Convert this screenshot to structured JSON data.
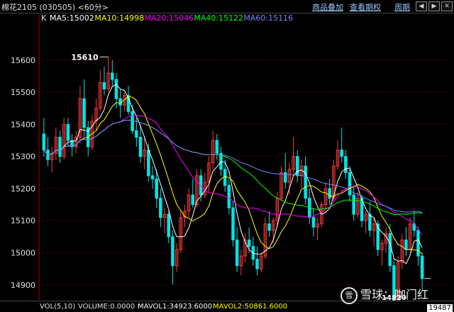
{
  "window": {
    "title": "棉花2105 (030505) <60分>",
    "buttons": [
      "商品叠加",
      "查看期权",
      "周期"
    ],
    "controls": [
      "◀",
      "▶",
      "✕"
    ]
  },
  "chart_data": {
    "type": "candlestick",
    "indicator_prefix": "K",
    "ma_legend": [
      {
        "label": "MA5:15002",
        "color": "#ffffff"
      },
      {
        "label": "MA10:14998",
        "color": "#ffff00"
      },
      {
        "label": "MA20:15046",
        "color": "#ff00ff"
      },
      {
        "label": "MA40:15122",
        "color": "#00ff00"
      },
      {
        "label": "MA60:15116",
        "color": "#8080ff"
      }
    ],
    "y_ticks": [
      15600,
      15500,
      15400,
      15300,
      15200,
      15100,
      15000,
      14900
    ],
    "ylim": [
      14862,
      15710
    ],
    "annotations": [
      {
        "text": "15610",
        "value": 15610
      },
      {
        "text": "14820",
        "value": 14820
      }
    ],
    "colors": {
      "up": "#ff3a3a",
      "down": "#00e5e5",
      "grid": "#8b0000"
    },
    "candles": [
      [
        15370,
        15420,
        15300,
        15320
      ],
      [
        15320,
        15360,
        15270,
        15290
      ],
      [
        15290,
        15330,
        15250,
        15310
      ],
      [
        15310,
        15390,
        15290,
        15360
      ],
      [
        15360,
        15380,
        15280,
        15300
      ],
      [
        15300,
        15420,
        15290,
        15400
      ],
      [
        15400,
        15420,
        15330,
        15350
      ],
      [
        15350,
        15370,
        15300,
        15330
      ],
      [
        15330,
        15380,
        15310,
        15360
      ],
      [
        15360,
        15520,
        15340,
        15480
      ],
      [
        15480,
        15540,
        15360,
        15390
      ],
      [
        15390,
        15410,
        15300,
        15330
      ],
      [
        15330,
        15430,
        15320,
        15410
      ],
      [
        15410,
        15480,
        15380,
        15450
      ],
      [
        15450,
        15570,
        15440,
        15530
      ],
      [
        15530,
        15580,
        15490,
        15510
      ],
      [
        15510,
        15610,
        15500,
        15560
      ],
      [
        15560,
        15600,
        15520,
        15540
      ],
      [
        15540,
        15560,
        15450,
        15480
      ],
      [
        15480,
        15510,
        15420,
        15460
      ],
      [
        15460,
        15500,
        15440,
        15490
      ],
      [
        15490,
        15520,
        15430,
        15440
      ],
      [
        15440,
        15460,
        15370,
        15380
      ],
      [
        15380,
        15420,
        15330,
        15360
      ],
      [
        15360,
        15400,
        15280,
        15300
      ],
      [
        15300,
        15360,
        15260,
        15320
      ],
      [
        15320,
        15340,
        15220,
        15240
      ],
      [
        15240,
        15270,
        15200,
        15230
      ],
      [
        15230,
        15260,
        15140,
        15170
      ],
      [
        15170,
        15200,
        15080,
        15110
      ],
      [
        15110,
        15140,
        15060,
        15120
      ],
      [
        15120,
        15130,
        15030,
        15050
      ],
      [
        15050,
        15070,
        14900,
        14960
      ],
      [
        14960,
        15030,
        14940,
        15010
      ],
      [
        15010,
        15130,
        15000,
        15110
      ],
      [
        15110,
        15150,
        15080,
        15130
      ],
      [
        15130,
        15200,
        15110,
        15180
      ],
      [
        15180,
        15230,
        15140,
        15150
      ],
      [
        15150,
        15260,
        15140,
        15240
      ],
      [
        15240,
        15260,
        15160,
        15180
      ],
      [
        15180,
        15250,
        15170,
        15220
      ],
      [
        15220,
        15300,
        15190,
        15280
      ],
      [
        15280,
        15380,
        15260,
        15350
      ],
      [
        15350,
        15370,
        15290,
        15310
      ],
      [
        15310,
        15330,
        15240,
        15260
      ],
      [
        15260,
        15290,
        15190,
        15210
      ],
      [
        15210,
        15230,
        15120,
        15140
      ],
      [
        15140,
        15160,
        15020,
        15040
      ],
      [
        15040,
        15080,
        14940,
        14960
      ],
      [
        14960,
        15010,
        14930,
        14990
      ],
      [
        14990,
        15060,
        14970,
        15040
      ],
      [
        15040,
        15080,
        15000,
        15020
      ],
      [
        15020,
        15050,
        14960,
        14980
      ],
      [
        14980,
        15020,
        14930,
        14950
      ],
      [
        14950,
        15000,
        14940,
        14990
      ],
      [
        14990,
        15110,
        14980,
        15090
      ],
      [
        15090,
        15130,
        15050,
        15070
      ],
      [
        15070,
        15110,
        15030,
        15100
      ],
      [
        15100,
        15190,
        15080,
        15170
      ],
      [
        15170,
        15270,
        15160,
        15250
      ],
      [
        15250,
        15310,
        15200,
        15220
      ],
      [
        15220,
        15280,
        15180,
        15260
      ],
      [
        15260,
        15360,
        15240,
        15300
      ],
      [
        15300,
        15320,
        15220,
        15240
      ],
      [
        15240,
        15290,
        15200,
        15270
      ],
      [
        15270,
        15300,
        15150,
        15170
      ],
      [
        15170,
        15200,
        15090,
        15110
      ],
      [
        15110,
        15140,
        15050,
        15080
      ],
      [
        15080,
        15110,
        15040,
        15090
      ],
      [
        15090,
        15160,
        15080,
        15150
      ],
      [
        15150,
        15220,
        15130,
        15200
      ],
      [
        15200,
        15230,
        15150,
        15170
      ],
      [
        15170,
        15290,
        15160,
        15270
      ],
      [
        15270,
        15350,
        15260,
        15320
      ],
      [
        15320,
        15390,
        15280,
        15300
      ],
      [
        15300,
        15320,
        15230,
        15250
      ],
      [
        15250,
        15270,
        15160,
        15180
      ],
      [
        15180,
        15210,
        15100,
        15120
      ],
      [
        15120,
        15190,
        15110,
        15170
      ],
      [
        15170,
        15180,
        15080,
        15100
      ],
      [
        15100,
        15130,
        15060,
        15120
      ],
      [
        15120,
        15160,
        15050,
        15070
      ],
      [
        15070,
        15110,
        15020,
        15090
      ],
      [
        15090,
        15100,
        14990,
        15010
      ],
      [
        15010,
        15040,
        14960,
        15030
      ],
      [
        15030,
        15080,
        15000,
        15060
      ],
      [
        15060,
        15090,
        14940,
        14960
      ],
      [
        14960,
        14980,
        14820,
        14850
      ],
      [
        14850,
        14990,
        14840,
        14970
      ],
      [
        14970,
        15060,
        14950,
        15040
      ],
      [
        15040,
        15080,
        14990,
        15010
      ],
      [
        15010,
        15110,
        15000,
        15090
      ],
      [
        15090,
        15130,
        15050,
        15070
      ],
      [
        15070,
        15080,
        14960,
        14990
      ],
      [
        14990,
        15000,
        14880,
        14920
      ]
    ]
  },
  "bottom": {
    "vol_label": "VOL(5,10)",
    "volume": "VOLUME:0.0000",
    "mavol1": "MAVOL1:34923.6000",
    "mavol2": "MAVOL2:50861.6000",
    "volume_readout": "19487"
  },
  "watermark": {
    "logo": "雪",
    "text": "雪球：咖门红"
  }
}
